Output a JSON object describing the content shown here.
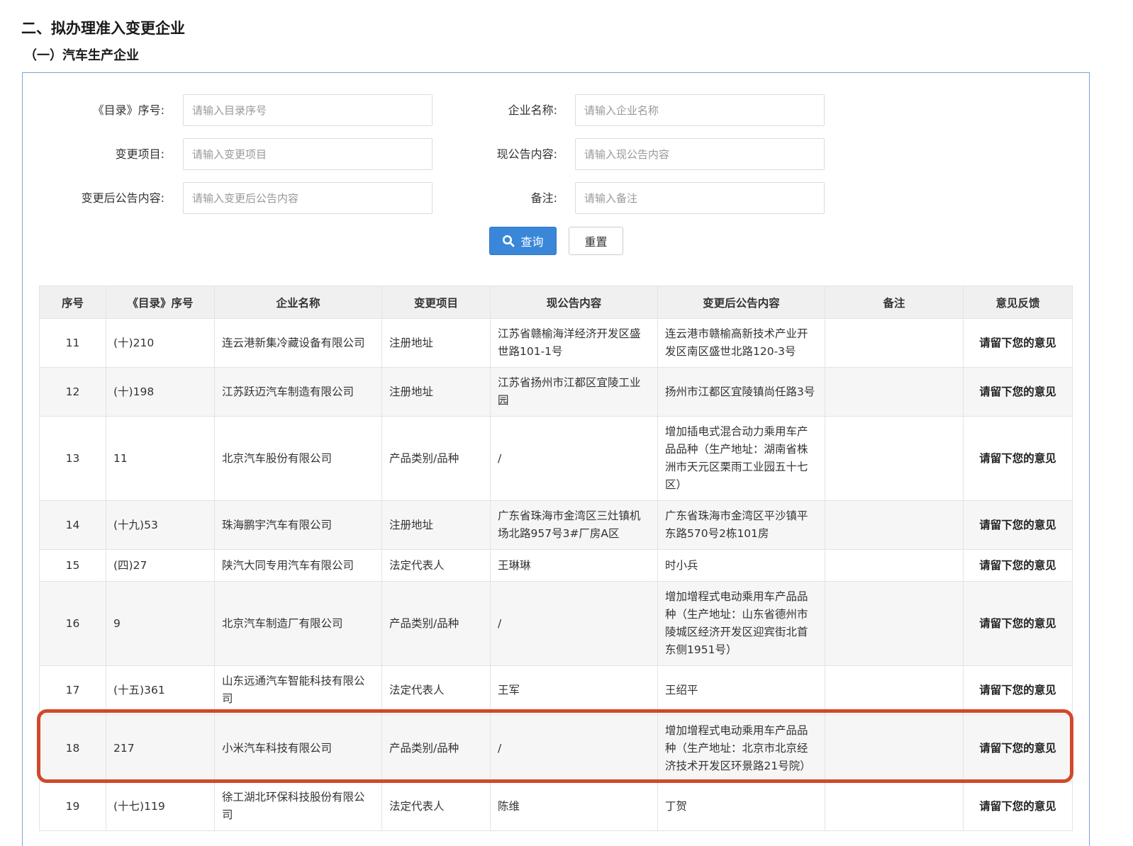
{
  "headings": {
    "section": "二、拟办理准入变更企业",
    "subsection": "（一）汽车生产企业"
  },
  "form": {
    "catalog_no": {
      "label": "《目录》序号:",
      "placeholder": "请输入目录序号"
    },
    "company": {
      "label": "企业名称:",
      "placeholder": "请输入企业名称"
    },
    "change_item": {
      "label": "变更项目:",
      "placeholder": "请输入变更项目"
    },
    "current_content": {
      "label": "现公告内容:",
      "placeholder": "请输入现公告内容"
    },
    "new_content": {
      "label": "变更后公告内容:",
      "placeholder": "请输入变更后公告内容"
    },
    "remark": {
      "label": "备注:",
      "placeholder": "请输入备注"
    },
    "query_label": "查询",
    "reset_label": "重置"
  },
  "table": {
    "columns": [
      "序号",
      "《目录》序号",
      "企业名称",
      "变更项目",
      "现公告内容",
      "变更后公告内容",
      "备注",
      "意见反馈"
    ],
    "rows": [
      {
        "no": "11",
        "catalog": "(十)210",
        "company": "连云港新集冷藏设备有限公司",
        "item": "注册地址",
        "current": "江苏省赣榆海洋经济开发区盛世路101-1号",
        "after": "连云港市赣榆高新技术产业开发区南区盛世北路120-3号",
        "remark": "",
        "feedback": "请留下您的意见"
      },
      {
        "no": "12",
        "catalog": "(十)198",
        "company": "江苏跃迈汽车制造有限公司",
        "item": "注册地址",
        "current": "江苏省扬州市江都区宜陵工业园",
        "after": "扬州市江都区宜陵镇尚任路3号",
        "remark": "",
        "feedback": "请留下您的意见"
      },
      {
        "no": "13",
        "catalog": "11",
        "company": "北京汽车股份有限公司",
        "item": "产品类别/品种",
        "current": "/",
        "after": "增加插电式混合动力乘用车产品品种（生产地址：湖南省株洲市天元区栗雨工业园五十七区）",
        "remark": "",
        "feedback": "请留下您的意见"
      },
      {
        "no": "14",
        "catalog": "(十九)53",
        "company": "珠海鹏宇汽车有限公司",
        "item": "注册地址",
        "current": "广东省珠海市金湾区三灶镇机场北路957号3#厂房A区",
        "after": "广东省珠海市金湾区平沙镇平东路570号2栋101房",
        "remark": "",
        "feedback": "请留下您的意见"
      },
      {
        "no": "15",
        "catalog": "(四)27",
        "company": "陕汽大同专用汽车有限公司",
        "item": "法定代表人",
        "current": "王琳琳",
        "after": "时小兵",
        "remark": "",
        "feedback": "请留下您的意见"
      },
      {
        "no": "16",
        "catalog": "9",
        "company": "北京汽车制造厂有限公司",
        "item": "产品类别/品种",
        "current": "/",
        "after": "增加增程式电动乘用车产品品种（生产地址：山东省德州市陵城区经济开发区迎宾街北首东侧1951号）",
        "remark": "",
        "feedback": "请留下您的意见"
      },
      {
        "no": "17",
        "catalog": "(十五)361",
        "company": "山东远通汽车智能科技有限公司",
        "item": "法定代表人",
        "current": "王军",
        "after": "王绍平",
        "remark": "",
        "feedback": "请留下您的意见"
      },
      {
        "no": "18",
        "catalog": "217",
        "company": "小米汽车科技有限公司",
        "item": "产品类别/品种",
        "current": "/",
        "after": "增加增程式电动乘用车产品品种（生产地址：北京市北京经济技术开发区环景路21号院）",
        "remark": "",
        "feedback": "请留下您的意见"
      },
      {
        "no": "19",
        "catalog": "(十七)119",
        "company": "徐工湖北环保科技股份有限公司",
        "item": "法定代表人",
        "current": "陈维",
        "after": "丁贺",
        "remark": "",
        "feedback": "请留下您的意见"
      }
    ]
  },
  "colors": {
    "accent": "#3a87d9",
    "highlight": "#d04a2a",
    "panel_border": "#7aa3d8"
  }
}
